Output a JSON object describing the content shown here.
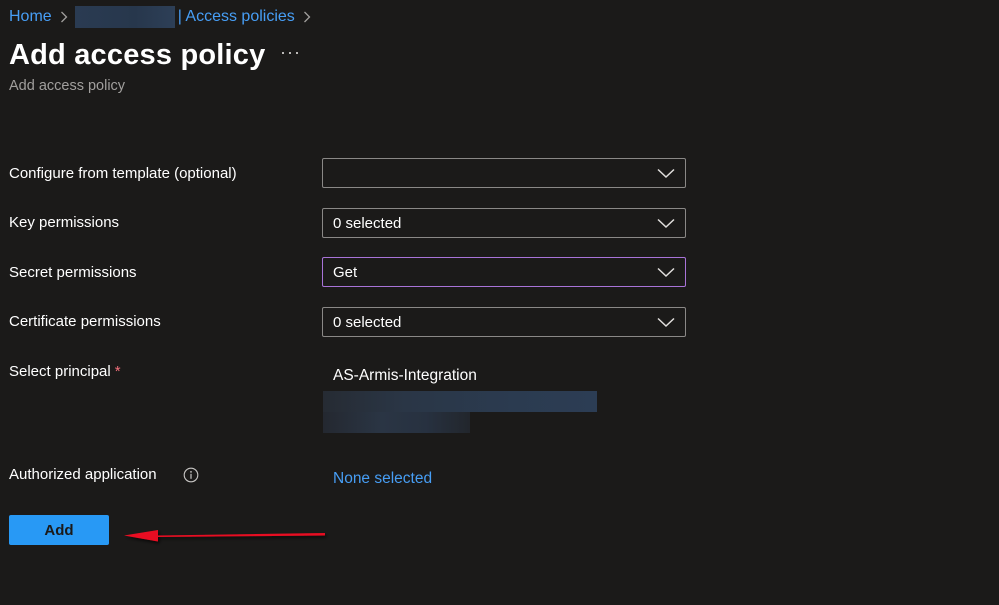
{
  "breadcrumb": {
    "home": "Home",
    "section": "| Access policies"
  },
  "header": {
    "title": "Add access policy",
    "subtitle": "Add access policy",
    "more": "···"
  },
  "form": {
    "template": {
      "label": "Configure from template (optional)",
      "value": ""
    },
    "key_permissions": {
      "label": "Key permissions",
      "value": "0 selected"
    },
    "secret_permissions": {
      "label": "Secret permissions",
      "value": "Get"
    },
    "certificate_permissions": {
      "label": "Certificate permissions",
      "value": "0 selected"
    },
    "principal": {
      "label": "Select principal",
      "required": "*",
      "value": "AS-Armis-Integration"
    },
    "authorized_application": {
      "label": "Authorized application",
      "value": "None selected"
    }
  },
  "actions": {
    "add_label": "Add"
  },
  "colors": {
    "background": "#1b1a19",
    "link": "#479ef5",
    "primary_button": "#2899f5",
    "focus_border": "#a873d8",
    "annotation_arrow": "#e81123"
  },
  "icons": {
    "chevron": "chevron-down-icon",
    "info": "info-icon",
    "more": "more-icon",
    "arrow": "annotation-arrow"
  }
}
